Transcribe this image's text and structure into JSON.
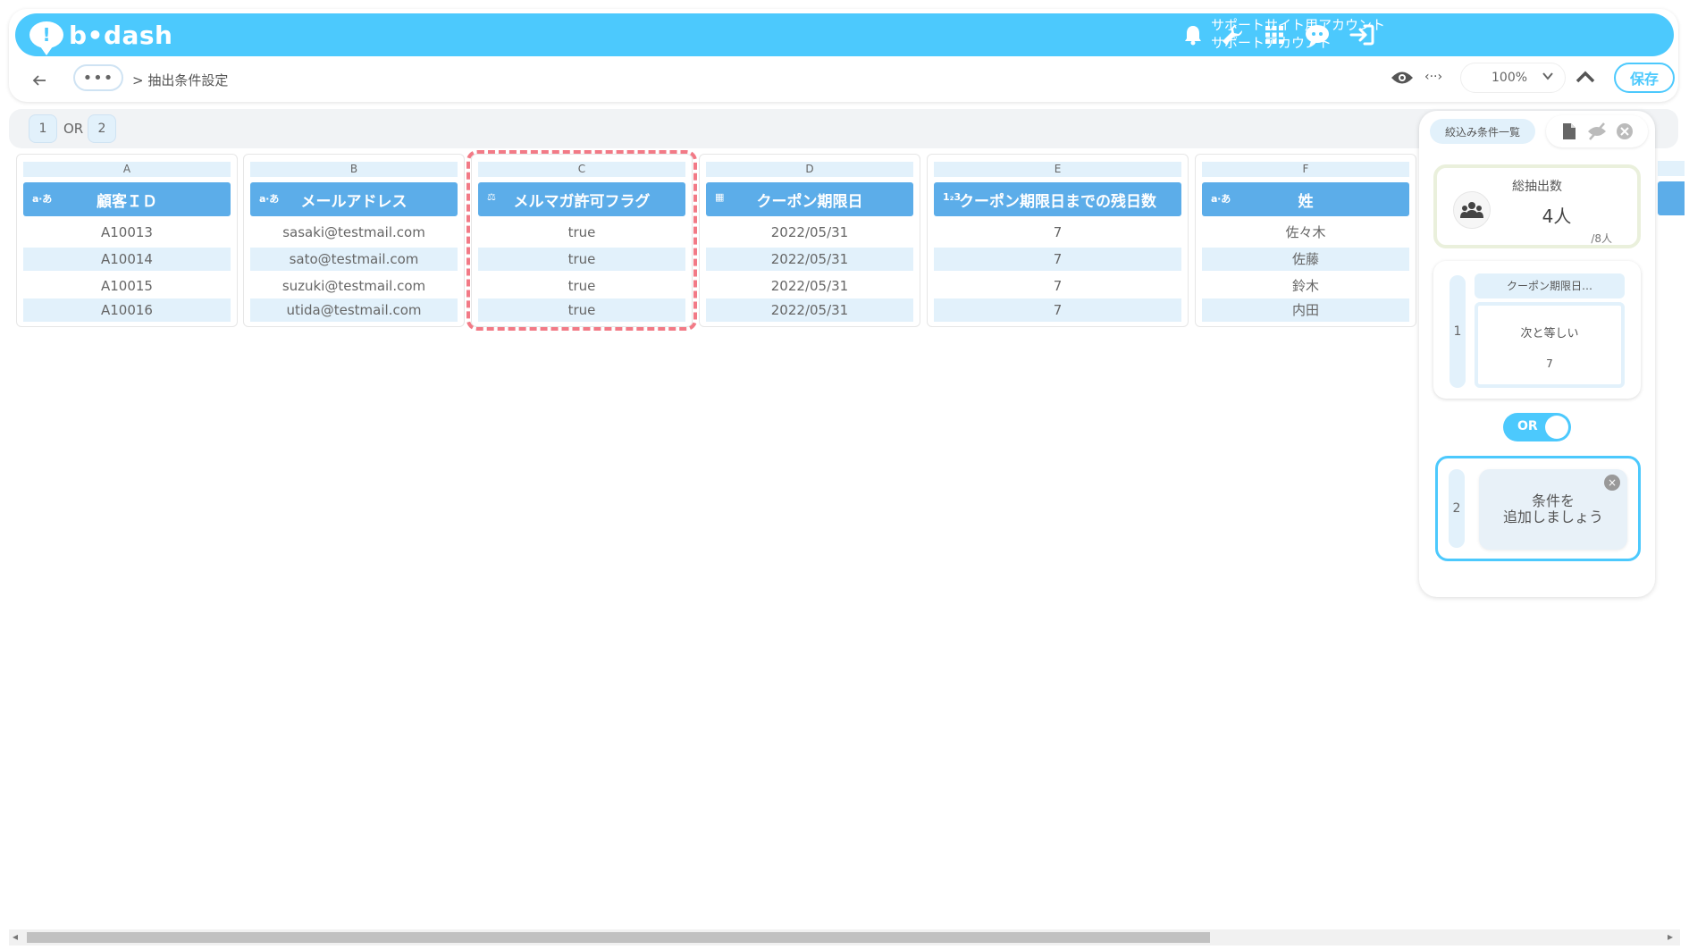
{
  "header": {
    "logo_text": "b•dash",
    "account_line1": "サポートサイト用アカウント",
    "account_line2": "サポートアカウント"
  },
  "breadcrumb": {
    "more": "•••",
    "current": "> 抽出条件設定"
  },
  "toolbar": {
    "code_symbol": "‹··›",
    "zoom": "100%",
    "save_label": "保存"
  },
  "condition_strip": {
    "badge1": "1",
    "or_text": "OR",
    "badge2": "2"
  },
  "columns": [
    {
      "letter": "A",
      "type_icon": "a‧あ",
      "title": "顧客ＩＤ",
      "cells": [
        "A10013",
        "A10014",
        "A10015",
        "A10016"
      ]
    },
    {
      "letter": "B",
      "type_icon": "a‧あ",
      "title": "メールアドレス",
      "cells": [
        "sasaki@testmail.com",
        "sato@testmail.com",
        "suzuki@testmail.com",
        "utida@testmail.com"
      ]
    },
    {
      "letter": "C",
      "type_icon": "⚖",
      "title": "メルマガ許可フラグ",
      "cells": [
        "true",
        "true",
        "true",
        "true"
      ]
    },
    {
      "letter": "D",
      "type_icon": "▦",
      "title": "クーポン期限日",
      "cells": [
        "2022/05/31",
        "2022/05/31",
        "2022/05/31",
        "2022/05/31"
      ]
    },
    {
      "letter": "E",
      "type_icon": "1₂3",
      "title": "クーポン期限日までの残日数",
      "cells": [
        "7",
        "7",
        "7",
        "7"
      ]
    },
    {
      "letter": "F",
      "type_icon": "a‧あ",
      "title": "姓",
      "cells": [
        "佐々木",
        "佐藤",
        "鈴木",
        "内田"
      ]
    }
  ],
  "panel": {
    "filter_list_label": "絞込み条件一覧",
    "total_title": "総抽出数",
    "total_count": "4人",
    "total_denominator": "/8人",
    "condition1": {
      "number": "1",
      "title": "クーポン期限日…",
      "operator": "次と等しい",
      "value": "7"
    },
    "toggle_label": "OR",
    "condition2": {
      "number": "2",
      "add_line1": "条件を",
      "add_line2": "追加しましょう",
      "close": "×"
    }
  },
  "colors": {
    "header_bg": "#4cc9fd",
    "column_header": "#5cade9",
    "alt_row": "#e2f1fb",
    "highlight": "#f27a86"
  }
}
